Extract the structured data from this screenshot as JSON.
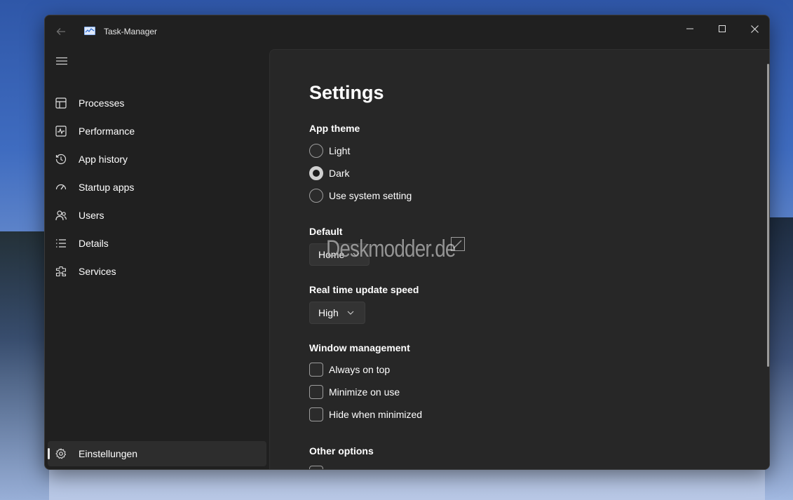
{
  "window": {
    "title": "Task-Manager",
    "controls": {
      "minimize": "—",
      "maximize": "☐",
      "close": "✕"
    }
  },
  "sidebar": {
    "items": [
      {
        "label": "Processes",
        "icon": "processes-icon"
      },
      {
        "label": "Performance",
        "icon": "performance-icon"
      },
      {
        "label": "App history",
        "icon": "app-history-icon"
      },
      {
        "label": "Startup apps",
        "icon": "startup-apps-icon"
      },
      {
        "label": "Users",
        "icon": "users-icon"
      },
      {
        "label": "Details",
        "icon": "details-icon"
      },
      {
        "label": "Services",
        "icon": "services-icon"
      }
    ],
    "settings": {
      "label": "Einstellungen",
      "icon": "gear-icon",
      "active": true
    }
  },
  "settings": {
    "title": "Settings",
    "app_theme": {
      "heading": "App theme",
      "options": [
        {
          "label": "Light",
          "checked": false
        },
        {
          "label": "Dark",
          "checked": true
        },
        {
          "label": "Use system setting",
          "checked": false
        }
      ]
    },
    "default": {
      "heading": "Default",
      "value": "Home"
    },
    "update_speed": {
      "heading": "Real time update speed",
      "value": "High"
    },
    "window_management": {
      "heading": "Window management",
      "options": [
        {
          "label": "Always on top",
          "checked": false
        },
        {
          "label": "Minimize on use",
          "checked": false
        },
        {
          "label": "Hide when minimized",
          "checked": false
        }
      ]
    },
    "other_options": {
      "heading": "Other options"
    }
  },
  "watermark": "Deskmodder.de",
  "colors": {
    "window_bg": "#202020",
    "content_bg": "#272727",
    "active_nav": "#2d2d2d",
    "text": "#ffffff"
  }
}
